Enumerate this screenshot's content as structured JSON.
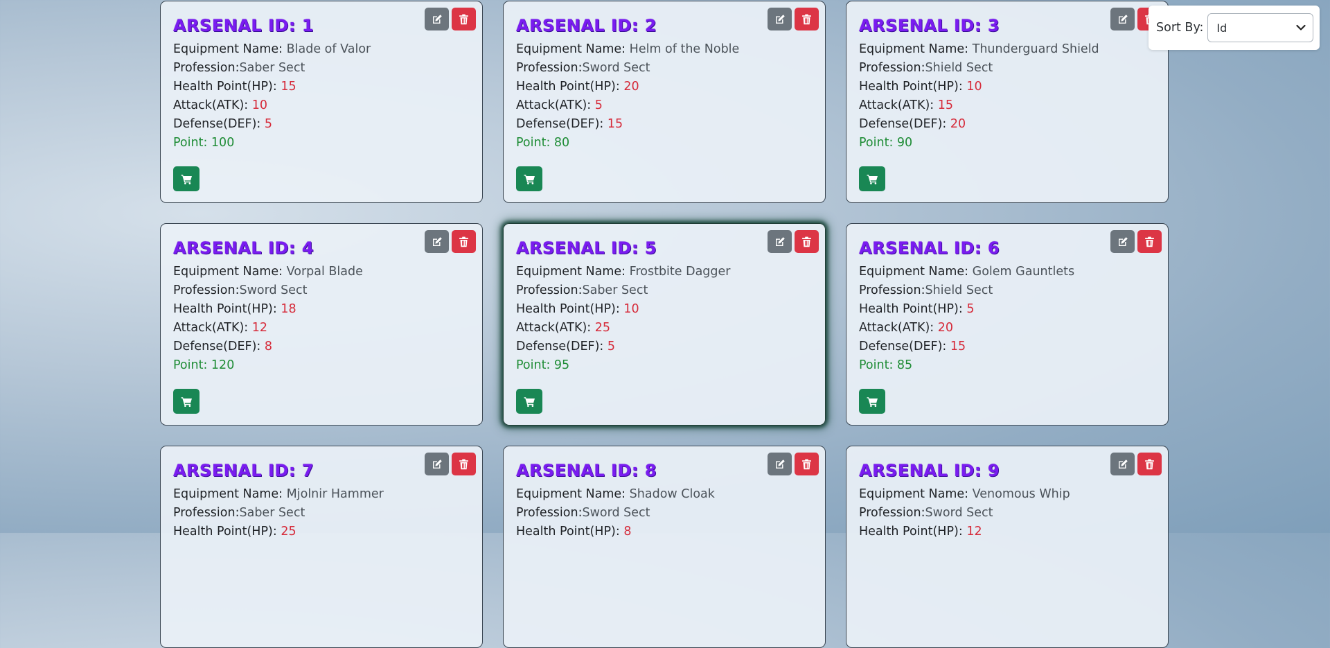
{
  "labels": {
    "title_prefix": "ARSENAL ID: ",
    "equipment_name": "Equipment Name: ",
    "profession": "Profession:",
    "hp": "Health Point(HP): ",
    "atk": "Attack(ATK): ",
    "def": "Defense(DEF): ",
    "point": "Point: "
  },
  "sort": {
    "label": "Sort By:",
    "selected": "Id"
  },
  "colors": {
    "title": "#7a1cf0",
    "stat_value": "#d62b3a",
    "point": "#1e8c35",
    "edit_button": "#6c757d",
    "delete_button": "#dc3545",
    "cart_button": "#198754"
  },
  "cards": [
    {
      "id": "1",
      "name": "Blade of Valor",
      "profession": "Saber Sect",
      "hp": "15",
      "atk": "10",
      "def": "5",
      "point": "100",
      "focused": false
    },
    {
      "id": "2",
      "name": "Helm of the Noble",
      "profession": "Sword Sect",
      "hp": "20",
      "atk": "5",
      "def": "15",
      "point": "80",
      "focused": false
    },
    {
      "id": "3",
      "name": "Thunderguard Shield",
      "profession": "Shield Sect",
      "hp": "10",
      "atk": "15",
      "def": "20",
      "point": "90",
      "focused": false
    },
    {
      "id": "4",
      "name": "Vorpal Blade",
      "profession": "Sword Sect",
      "hp": "18",
      "atk": "12",
      "def": "8",
      "point": "120",
      "focused": false
    },
    {
      "id": "5",
      "name": "Frostbite Dagger",
      "profession": "Saber Sect",
      "hp": "10",
      "atk": "25",
      "def": "5",
      "point": "95",
      "focused": true
    },
    {
      "id": "6",
      "name": "Golem Gauntlets",
      "profession": "Shield Sect",
      "hp": "5",
      "atk": "20",
      "def": "15",
      "point": "85",
      "focused": false
    },
    {
      "id": "7",
      "name": "Mjolnir Hammer",
      "profession": "Saber Sect",
      "hp": "25",
      "atk": null,
      "def": null,
      "point": null,
      "focused": false
    },
    {
      "id": "8",
      "name": "Shadow Cloak",
      "profession": "Sword Sect",
      "hp": "8",
      "atk": null,
      "def": null,
      "point": null,
      "focused": false
    },
    {
      "id": "9",
      "name": "Venomous Whip",
      "profession": "Sword Sect",
      "hp": "12",
      "atk": null,
      "def": null,
      "point": null,
      "focused": false
    }
  ]
}
